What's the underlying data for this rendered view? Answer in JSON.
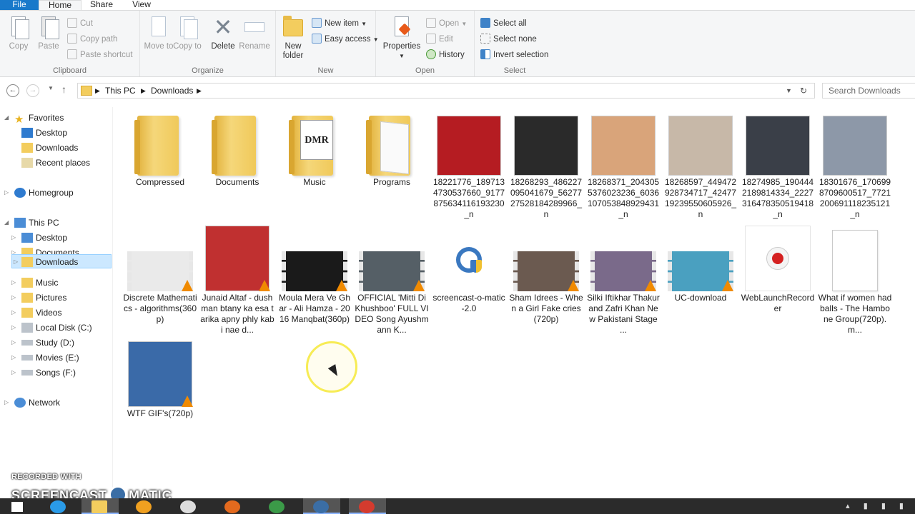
{
  "ribbon_tabs": [
    "File",
    "Home",
    "Share",
    "View"
  ],
  "clipboard": {
    "label": "Clipboard",
    "copy": "Copy",
    "paste": "Paste",
    "cut": "Cut",
    "copy_path": "Copy path",
    "paste_shortcut": "Paste shortcut"
  },
  "organize": {
    "label": "Organize",
    "move_to": "Move to",
    "copy_to": "Copy to",
    "delete": "Delete",
    "rename": "Rename"
  },
  "new_group": {
    "label": "New",
    "new_folder": "New folder",
    "new_item": "New item",
    "easy_access": "Easy access"
  },
  "open_group": {
    "label": "Open",
    "properties": "Properties",
    "open": "Open",
    "edit": "Edit",
    "history": "History"
  },
  "select_group": {
    "label": "Select",
    "select_all": "Select all",
    "select_none": "Select none",
    "invert_selection": "Invert selection"
  },
  "address": {
    "crumbs": [
      "This PC",
      "Downloads"
    ],
    "search_placeholder": "Search Downloads"
  },
  "nav": {
    "favorites": "Favorites",
    "fav_items": [
      "Desktop",
      "Downloads",
      "Recent places"
    ],
    "homegroup": "Homegroup",
    "this_pc": "This PC",
    "pc_items": [
      "Desktop",
      "Documents",
      "Downloads",
      "Music",
      "Pictures",
      "Videos",
      "Local Disk (C:)",
      "Study (D:)",
      "Movies (E:)",
      "Songs (F:)"
    ],
    "network": "Network"
  },
  "files": {
    "row1": [
      {
        "name": "Compressed",
        "kind": "folder"
      },
      {
        "name": "Documents",
        "kind": "folder"
      },
      {
        "name": "Music",
        "kind": "folder-doc"
      },
      {
        "name": "Programs",
        "kind": "folder-open"
      },
      {
        "name": "18221776_1897134730537660_9177875634116193230_n",
        "kind": "image",
        "color": "#b51c22"
      },
      {
        "name": "18268293_486227095041679_5627727528184289966_n",
        "kind": "image",
        "color": "#2a2a2a"
      },
      {
        "name": "18268371_2043055376023236_6036107053848929431_n",
        "kind": "image",
        "color": "#d9a47a"
      },
      {
        "name": "18268597_449472928734717_4247719239550605926_n",
        "kind": "image",
        "color": "#c7b8a8"
      },
      {
        "name": "18274985_1904442189814334_2227316478350519418_n",
        "kind": "image",
        "color": "#3a3f48"
      },
      {
        "name": "18301676_1706998709600517_7721200691118235121_n",
        "kind": "image",
        "color": "#8d98a8"
      }
    ],
    "row2": [
      {
        "name": "Discrete Mathematics - algorithms(360p)",
        "kind": "video",
        "color": "#eaeaea"
      },
      {
        "name": "Junaid Altaf - dushman btany ka esa tarika apny phly kabi nae d...",
        "kind": "video-tall",
        "color": "#c03030"
      },
      {
        "name": "Moula Mera Ve Ghar - Ali Hamza - 2016 Manqbat(360p)",
        "kind": "video",
        "color": "#1a1a1a"
      },
      {
        "name": "OFFICIAL 'Mitti Di Khushboo' FULL VIDEO Song Ayushmann K...",
        "kind": "video",
        "color": "#555f66"
      },
      {
        "name": "screencast-o-matic-2.0",
        "kind": "app",
        "color": "#3a78c0"
      },
      {
        "name": "Sham Idrees - When a Girl Fake cries(720p)",
        "kind": "video",
        "color": "#6b5a50"
      },
      {
        "name": "Silki Iftikhar Thakur and Zafri Khan New Pakistani Stage ...",
        "kind": "video",
        "color": "#7a6a8a"
      },
      {
        "name": "UC-download",
        "kind": "video",
        "color": "#4aa0c0"
      },
      {
        "name": "WebLaunchRecorder",
        "kind": "record",
        "color": "#d42020"
      },
      {
        "name": "What if women had balls - The Hambone Group(720p).m...",
        "kind": "blank",
        "color": "#ffffff"
      }
    ],
    "row3": [
      {
        "name": "WTF GIF's(720p)",
        "kind": "video-tall",
        "color": "#3a6aa8"
      }
    ]
  },
  "watermark": {
    "line1": "RECORDED WITH",
    "line2a": "SCREENCAST",
    "line2b": "MATIC"
  },
  "colors": {
    "accent": "#1979ca",
    "selection": "#cce8ff",
    "highlight": "#f7ec55"
  }
}
